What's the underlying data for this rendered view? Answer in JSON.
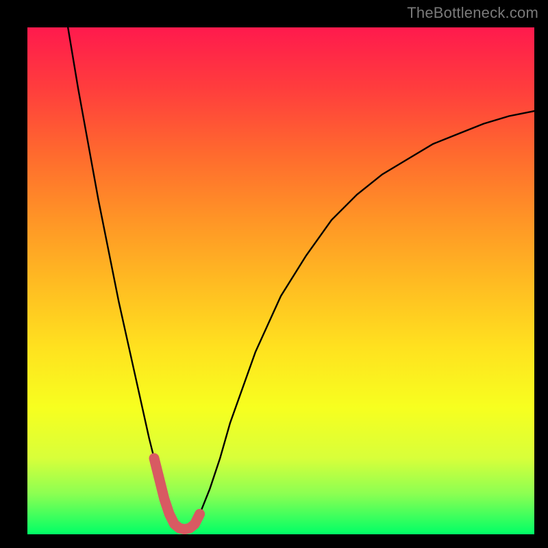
{
  "watermark": "TheBottleneck.com",
  "colors": {
    "frame_bg": "#000000",
    "gradient_top": "#ff1a4d",
    "gradient_bottom": "#00ff66",
    "curve": "#000000",
    "marker": "#d85a62"
  },
  "chart_data": {
    "type": "line",
    "title": "",
    "xlabel": "",
    "ylabel": "",
    "xlim": [
      0,
      100
    ],
    "ylim": [
      0,
      100
    ],
    "grid": false,
    "legend": false,
    "series": [
      {
        "name": "curve",
        "x": [
          8,
          10,
          12,
          14,
          16,
          18,
          20,
          22,
          24,
          25,
          26,
          27,
          28,
          29,
          30,
          31,
          32,
          33,
          34,
          36,
          38,
          40,
          45,
          50,
          55,
          60,
          65,
          70,
          75,
          80,
          85,
          90,
          95,
          100
        ],
        "values": [
          100,
          88,
          77,
          66,
          56,
          46,
          37,
          28,
          19,
          15,
          11,
          7,
          4,
          2,
          1.2,
          1.0,
          1.2,
          2,
          4,
          9,
          15,
          22,
          36,
          47,
          55,
          62,
          67,
          71,
          74,
          77,
          79,
          81,
          82.5,
          83.5
        ]
      },
      {
        "name": "marker",
        "x": [
          25,
          26,
          27,
          28,
          29,
          30,
          31,
          32,
          33,
          34
        ],
        "values": [
          15,
          11,
          7,
          4,
          2,
          1.2,
          1.0,
          1.2,
          2,
          4
        ]
      }
    ]
  }
}
